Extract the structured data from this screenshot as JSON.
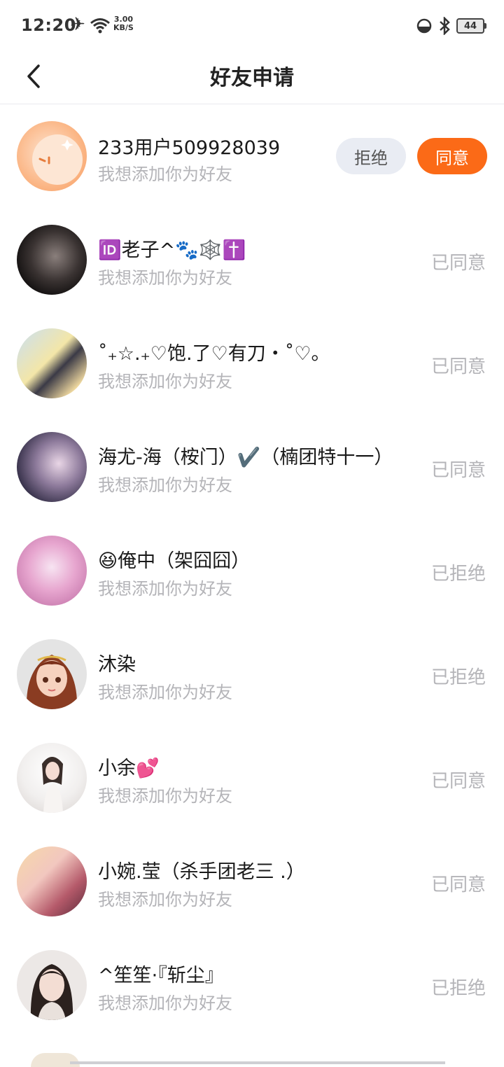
{
  "status_bar": {
    "time": "12:20",
    "net_speed_value": "3.00",
    "net_speed_unit": "KB/S",
    "battery": "44"
  },
  "header": {
    "title": "好友申请"
  },
  "requests": [
    {
      "name": "233用户509928039",
      "message": "我想添加你为好友",
      "reject_label": "拒绝",
      "accept_label": "同意"
    },
    {
      "name": "🆔老子^🐾🕸️✝️",
      "message": "我想添加你为好友",
      "status": "已同意"
    },
    {
      "name": "˚₊☆.₊♡饱.了♡有刀・˚♡。",
      "message": "我想添加你为好友",
      "status": "已同意"
    },
    {
      "name": "海尤-海（桉门）✔️（楠团特十一）",
      "message": "我想添加你为好友",
      "status": "已同意"
    },
    {
      "name": "😆俺中（架囧囧）",
      "message": "我想添加你为好友",
      "status": "已拒绝"
    },
    {
      "name": "沐染",
      "message": "我想添加你为好友",
      "status": "已拒绝"
    },
    {
      "name": "小余💕",
      "message": "我想添加你为好友",
      "status": "已同意"
    },
    {
      "name": "小婉.莹（杀手团老三 .）",
      "message": "我想添加你为好友",
      "status": "已同意"
    },
    {
      "name": "^笙笙·『斩尘』",
      "message": "我想添加你为好友",
      "status": "已拒绝"
    }
  ],
  "colors": {
    "accent": "#fb6a17",
    "reject_bg": "#e9ecf3",
    "muted_text": "#b4b4b8"
  }
}
